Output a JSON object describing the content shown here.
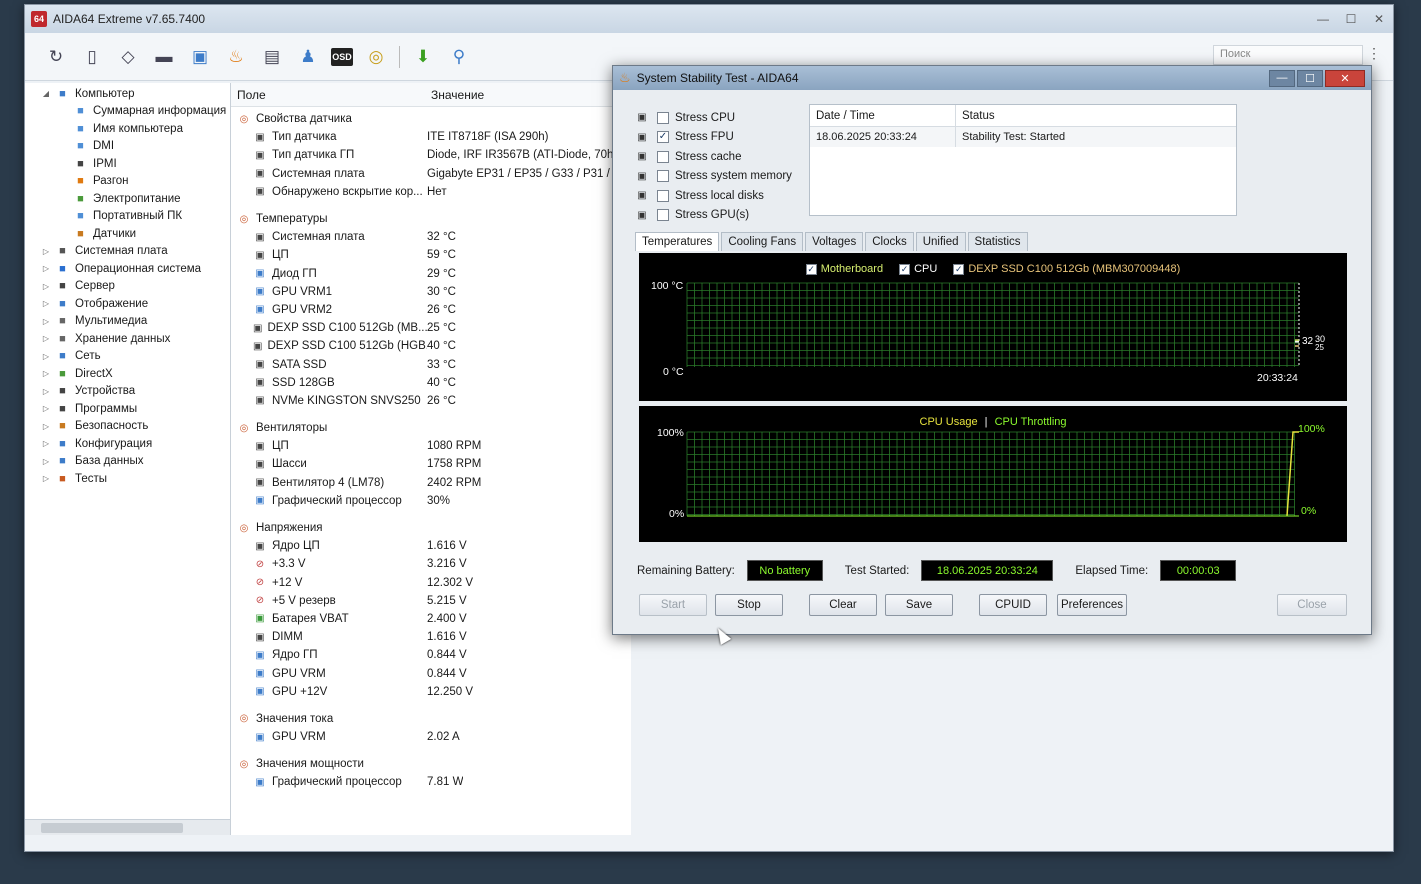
{
  "app": {
    "title": "AIDA64 Extreme v7.65.7400",
    "icon_text": "64",
    "search_placeholder": "Поиск"
  },
  "toolbar": {
    "icons": [
      "refresh-icon",
      "report-icon",
      "network-icon",
      "memory-icon",
      "computer-icon",
      "flame-icon",
      "clipboard-icon",
      "user-icon",
      "osd-icon",
      "gauge-icon",
      "download-icon",
      "search-icon"
    ],
    "osd_label": "OSD"
  },
  "tree": {
    "items": [
      {
        "label": "Компьютер",
        "level": 0,
        "exp": "◢",
        "icon": "computer-icon",
        "color": "#3d7cc9"
      },
      {
        "label": "Суммарная информация",
        "level": 1,
        "icon": "summary-icon",
        "color": "#4f8fd6"
      },
      {
        "label": "Имя компьютера",
        "level": 1,
        "icon": "computer-name-icon",
        "color": "#4f8fd6"
      },
      {
        "label": "DMI",
        "level": 1,
        "icon": "dmi-icon",
        "color": "#4f8fd6"
      },
      {
        "label": "IPMI",
        "level": 1,
        "icon": "ipmi-icon",
        "color": "#444"
      },
      {
        "label": "Разгон",
        "level": 1,
        "icon": "overclock-icon",
        "color": "#e07a10"
      },
      {
        "label": "Электропитание",
        "level": 1,
        "icon": "power-icon",
        "color": "#4a9a3a"
      },
      {
        "label": "Портативный ПК",
        "level": 1,
        "icon": "laptop-icon",
        "color": "#4f8fd6"
      },
      {
        "label": "Датчики",
        "level": 1,
        "icon": "sensor-icon",
        "color": "#c87a20"
      },
      {
        "label": "Системная плата",
        "level": 0,
        "exp": "▷",
        "icon": "motherboard-icon",
        "color": "#555"
      },
      {
        "label": "Операционная система",
        "level": 0,
        "exp": "▷",
        "icon": "windows-icon",
        "color": "#2a6fd0"
      },
      {
        "label": "Сервер",
        "level": 0,
        "exp": "▷",
        "icon": "server-icon",
        "color": "#444"
      },
      {
        "label": "Отображение",
        "level": 0,
        "exp": "▷",
        "icon": "display-icon",
        "color": "#3d7cc9"
      },
      {
        "label": "Мультимедиа",
        "level": 0,
        "exp": "▷",
        "icon": "multimedia-icon",
        "color": "#666"
      },
      {
        "label": "Хранение данных",
        "level": 0,
        "exp": "▷",
        "icon": "storage-icon",
        "color": "#666"
      },
      {
        "label": "Сеть",
        "level": 0,
        "exp": "▷",
        "icon": "network-icon",
        "color": "#3d7cc9"
      },
      {
        "label": "DirectX",
        "level": 0,
        "exp": "▷",
        "icon": "directx-icon",
        "color": "#4a9a3a"
      },
      {
        "label": "Устройства",
        "level": 0,
        "exp": "▷",
        "icon": "devices-icon",
        "color": "#444"
      },
      {
        "label": "Программы",
        "level": 0,
        "exp": "▷",
        "icon": "programs-icon",
        "color": "#444"
      },
      {
        "label": "Безопасность",
        "level": 0,
        "exp": "▷",
        "icon": "security-icon",
        "color": "#c87a20"
      },
      {
        "label": "Конфигурация",
        "level": 0,
        "exp": "▷",
        "icon": "config-icon",
        "color": "#3d7cc9"
      },
      {
        "label": "База данных",
        "level": 0,
        "exp": "▷",
        "icon": "database-icon",
        "color": "#3d7cc9"
      },
      {
        "label": "Тесты",
        "level": 0,
        "exp": "▷",
        "icon": "tests-icon",
        "color": "#c85a20"
      }
    ]
  },
  "list": {
    "col_field": "Поле",
    "col_value": "Значение",
    "rows": [
      {
        "group": true,
        "field": "Свойства датчика",
        "icon": "sensor-props-icon"
      },
      {
        "field": "Тип датчика",
        "value": "ITE IT8718F (ISA 290h)",
        "icon": "sensor-type-icon"
      },
      {
        "field": "Тип датчика ГП",
        "value": "Diode, IRF IR3567B (ATI-Diode, 70h",
        "icon": "gpu-sensor-icon"
      },
      {
        "field": "Системная плата",
        "value": "Gigabyte EP31 / EP35 / G33 / P31 / P",
        "icon": "motherboard-icon"
      },
      {
        "field": "Обнаружено вскрытие кор...",
        "value": "Нет",
        "icon": "shield-icon"
      },
      {
        "group": true,
        "field": "Температуры",
        "icon": "thermometer-icon"
      },
      {
        "field": "Системная плата",
        "value": "32 °C",
        "icon": "motherboard-icon"
      },
      {
        "field": "ЦП",
        "value": "59 °C",
        "icon": "cpu-icon"
      },
      {
        "field": "Диод ГП",
        "value": "29 °C",
        "icon": "gpu-icon"
      },
      {
        "field": "GPU VRM1",
        "value": "30 °C",
        "icon": "gpu-icon"
      },
      {
        "field": "GPU VRM2",
        "value": "26 °C",
        "icon": "gpu-icon"
      },
      {
        "field": "DEXP SSD C100 512Gb (MB...",
        "value": "25 °C",
        "icon": "drive-icon"
      },
      {
        "field": "DEXP SSD C100 512Gb (HGB...",
        "value": "40 °C",
        "icon": "drive-icon"
      },
      {
        "field": "SATA SSD",
        "value": "33 °C",
        "icon": "drive-icon"
      },
      {
        "field": "SSD 128GB",
        "value": "40 °C",
        "icon": "drive-icon"
      },
      {
        "field": "NVMe KINGSTON SNVS250",
        "value": "26 °C",
        "icon": "drive-icon"
      },
      {
        "group": true,
        "field": "Вентиляторы",
        "icon": "fan-group-icon"
      },
      {
        "field": "ЦП",
        "value": "1080 RPM",
        "icon": "cpu-icon"
      },
      {
        "field": "Шасси",
        "value": "1758 RPM",
        "icon": "chassis-icon"
      },
      {
        "field": "Вентилятор 4 (LM78)",
        "value": "2402 RPM",
        "icon": "fan-icon"
      },
      {
        "field": "Графический процессор",
        "value": "30%",
        "icon": "gpu-icon"
      },
      {
        "group": true,
        "field": "Напряжения",
        "icon": "voltage-group-icon"
      },
      {
        "field": "Ядро ЦП",
        "value": "1.616 V",
        "icon": "cpu-icon"
      },
      {
        "field": "+3.3 V",
        "value": "3.216 V",
        "icon": "voltage-icon"
      },
      {
        "field": "+12 V",
        "value": "12.302 V",
        "icon": "voltage-icon"
      },
      {
        "field": "+5 V резерв",
        "value": "5.215 V",
        "icon": "voltage-icon"
      },
      {
        "field": "Батарея VBAT",
        "value": "2.400 V",
        "icon": "battery-icon"
      },
      {
        "field": "DIMM",
        "value": "1.616 V",
        "icon": "memory-icon"
      },
      {
        "field": "Ядро ГП",
        "value": "0.844 V",
        "icon": "gpu-icon"
      },
      {
        "field": "GPU VRM",
        "value": "0.844 V",
        "icon": "gpu-icon"
      },
      {
        "field": "GPU +12V",
        "value": "12.250 V",
        "icon": "gpu-icon"
      },
      {
        "group": true,
        "field": "Значения тока",
        "icon": "current-group-icon"
      },
      {
        "field": "GPU VRM",
        "value": "2.02 A",
        "icon": "gpu-icon"
      },
      {
        "group": true,
        "field": "Значения мощности",
        "icon": "power-group-icon"
      },
      {
        "field": "Графический процессор",
        "value": "7.81 W",
        "icon": "gpu-icon"
      }
    ]
  },
  "dialog": {
    "title": "System Stability Test - AIDA64",
    "stress": [
      {
        "label": "Stress CPU",
        "checked": false,
        "icon": "cpu-chip-icon"
      },
      {
        "label": "Stress FPU",
        "checked": true,
        "icon": "fpu-chip-icon"
      },
      {
        "label": "Stress cache",
        "checked": false,
        "icon": "cache-chip-icon"
      },
      {
        "label": "Stress system memory",
        "checked": false,
        "icon": "memory-stick-icon"
      },
      {
        "label": "Stress local disks",
        "checked": false,
        "icon": "disk-icon"
      },
      {
        "label": "Stress GPU(s)",
        "checked": false,
        "icon": "gpu-card-icon"
      }
    ],
    "status_table": {
      "headers": [
        "Date / Time",
        "Status"
      ],
      "rows": [
        [
          "18.06.2025 20:33:24",
          "Stability Test: Started"
        ]
      ]
    },
    "tabs": [
      "Temperatures",
      "Cooling Fans",
      "Voltages",
      "Clocks",
      "Unified",
      "Statistics"
    ],
    "active_tab": "Temperatures",
    "temp_graph": {
      "legend": [
        {
          "label": "Motherboard",
          "checked": true
        },
        {
          "label": "CPU",
          "checked": true
        },
        {
          "label": "DEXP SSD C100 512Gb (MBM307009448)",
          "checked": true
        }
      ],
      "y_top": "100 °C",
      "y_bottom": "0 °C",
      "time": "20:33:24",
      "right_value": "32",
      "right_value2": "30",
      "right_value3": "25"
    },
    "usage_graph": {
      "title_a": "CPU Usage",
      "sep": "|",
      "title_b": "CPU Throttling",
      "y_top": "100%",
      "y_bottom": "0%",
      "right_top": "100%",
      "right_bottom": "0%"
    },
    "info": {
      "battery_label": "Remaining Battery:",
      "battery_value": "No battery",
      "started_label": "Test Started:",
      "started_value": "18.06.2025 20:33:24",
      "elapsed_label": "Elapsed Time:",
      "elapsed_value": "00:00:03"
    },
    "buttons": {
      "start": "Start",
      "stop": "Stop",
      "clear": "Clear",
      "save": "Save",
      "cpuid": "CPUID",
      "preferences": "Preferences",
      "close": "Close"
    }
  },
  "chart_data": [
    {
      "type": "line",
      "title": "",
      "ylabel": "",
      "ylim": [
        0,
        100
      ],
      "x": [
        "20:33:24"
      ],
      "series": [
        {
          "name": "Motherboard",
          "values": [
            32
          ]
        },
        {
          "name": "CPU",
          "values": [
            30
          ]
        },
        {
          "name": "DEXP SSD C100 512Gb (MBM307009448)",
          "values": [
            25
          ]
        }
      ],
      "grid": true
    },
    {
      "type": "line",
      "title": "",
      "ylim": [
        0,
        100
      ],
      "series": [
        {
          "name": "CPU Usage",
          "values": [
            100
          ]
        },
        {
          "name": "CPU Throttling",
          "values": [
            0
          ]
        }
      ],
      "grid": true
    }
  ]
}
